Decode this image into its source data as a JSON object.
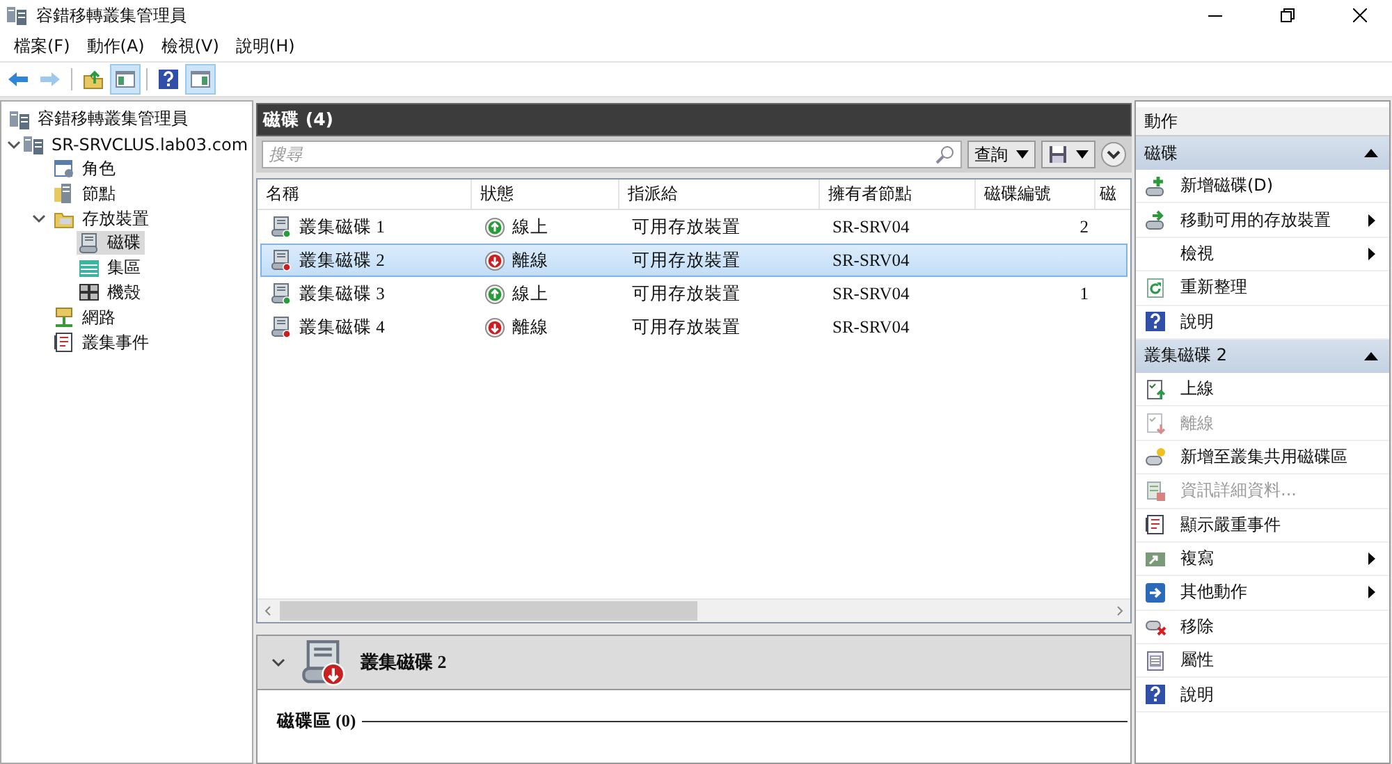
{
  "window": {
    "title": "容錯移轉叢集管理員"
  },
  "menu": [
    {
      "label": "檔案(F)"
    },
    {
      "label": "動作(A)"
    },
    {
      "label": "檢視(V)"
    },
    {
      "label": "說明(H)"
    }
  ],
  "toolbar": [
    {
      "kind": "back",
      "on": false,
      "disabled": false
    },
    {
      "kind": "forward",
      "on": false,
      "disabled": true
    },
    {
      "kind": "up",
      "on": false,
      "disabled": false
    },
    {
      "kind": "tree",
      "on": true,
      "disabled": false
    },
    {
      "kind": "help",
      "on": false,
      "disabled": false
    },
    {
      "kind": "actions",
      "on": true,
      "disabled": false
    }
  ],
  "tree": {
    "root": {
      "label": "容錯移轉叢集管理員",
      "kind": "cluster",
      "selected": false
    },
    "items": [
      {
        "label": "SR-SRVCLUS.lab03.com",
        "kind": "cluster",
        "selected": false,
        "expanded": true,
        "children": [
          {
            "label": "角色",
            "kind": "roles",
            "selected": false
          },
          {
            "label": "節點",
            "kind": "nodes",
            "selected": false
          },
          {
            "label": "存放裝置",
            "kind": "storage",
            "selected": false,
            "expanded": true,
            "children": [
              {
                "label": "磁碟",
                "kind": "disk",
                "selected": true
              },
              {
                "label": "集區",
                "kind": "pool",
                "selected": false
              },
              {
                "label": "機殼",
                "kind": "enclosure",
                "selected": false
              }
            ]
          },
          {
            "label": "網路",
            "kind": "network",
            "selected": false
          },
          {
            "label": "叢集事件",
            "kind": "events",
            "selected": false
          }
        ]
      }
    ]
  },
  "panel": {
    "title": "磁碟 (4)",
    "search": {
      "placeholder": "搜尋"
    },
    "query_button": "查詢",
    "columns": [
      "名稱",
      "狀態",
      "指派給",
      "擁有者節點",
      "磁碟編號",
      "磁"
    ],
    "rows": [
      {
        "name": "叢集磁碟 1",
        "status": "線上",
        "online": true,
        "assigned": "可用存放裝置",
        "owner": "SR-SRV04",
        "disk_number": "2",
        "selected": false
      },
      {
        "name": "叢集磁碟 2",
        "status": "離線",
        "online": false,
        "assigned": "可用存放裝置",
        "owner": "SR-SRV04",
        "selected": true
      },
      {
        "name": "叢集磁碟 3",
        "status": "線上",
        "online": true,
        "assigned": "可用存放裝置",
        "owner": "SR-SRV04",
        "disk_number": "1",
        "selected": false
      },
      {
        "name": "叢集磁碟 4",
        "status": "離線",
        "online": false,
        "assigned": "可用存放裝置",
        "owner": "SR-SRV04",
        "selected": false
      }
    ]
  },
  "detail": {
    "title": "叢集磁碟 2",
    "online": false,
    "expanded": true,
    "section": "磁碟區 (0)"
  },
  "actions": {
    "title": "動作",
    "groups": [
      {
        "title": "磁碟",
        "expanded": true,
        "items": [
          {
            "label": "新增磁碟(D)",
            "kind": "add-disk",
            "submenu": false,
            "disabled": false
          },
          {
            "label": "移動可用的存放裝置",
            "kind": "move",
            "submenu": true,
            "disabled": false
          },
          {
            "label": "檢視",
            "kind": "none",
            "submenu": true,
            "disabled": false
          },
          {
            "label": "重新整理",
            "kind": "refresh",
            "submenu": false,
            "disabled": false
          },
          {
            "label": "說明",
            "kind": "help",
            "submenu": false,
            "disabled": false
          }
        ]
      },
      {
        "title": "叢集磁碟 2",
        "expanded": true,
        "items": [
          {
            "label": "上線",
            "kind": "online",
            "submenu": false,
            "disabled": false
          },
          {
            "label": "離線",
            "kind": "offline",
            "submenu": false,
            "disabled": true
          },
          {
            "label": "新增至叢集共用磁碟區",
            "kind": "add-csv",
            "submenu": false,
            "disabled": false
          },
          {
            "label": "資訊詳細資料...",
            "kind": "info",
            "submenu": false,
            "disabled": true
          },
          {
            "label": "顯示嚴重事件",
            "kind": "events",
            "submenu": false,
            "disabled": false
          },
          {
            "label": "複寫",
            "kind": "replicate",
            "submenu": true,
            "disabled": false
          },
          {
            "label": "其他動作",
            "kind": "more",
            "submenu": true,
            "disabled": false
          },
          {
            "label": "移除",
            "kind": "remove",
            "submenu": false,
            "disabled": false
          },
          {
            "label": "屬性",
            "kind": "properties",
            "submenu": false,
            "disabled": false
          },
          {
            "label": "說明",
            "kind": "help",
            "submenu": false,
            "disabled": false
          }
        ]
      }
    ]
  }
}
